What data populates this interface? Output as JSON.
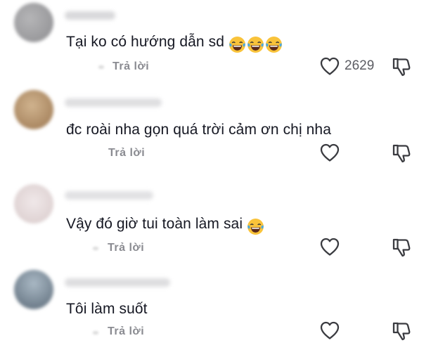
{
  "comments": [
    {
      "text": "Tại ko có hướng dẫn sd",
      "emoji_count": 3,
      "reply_label": "Trả lời",
      "like_count": "2629",
      "avatar_color": "#9a9a9c",
      "username_color": "#b9b9bd"
    },
    {
      "text": "đc roài nha gọn quá trời cảm ơn chị nha",
      "emoji_count": 0,
      "reply_label": "Trả lời",
      "like_count": "",
      "avatar_color": "#b08a62",
      "username_color": "#c4c4c8"
    },
    {
      "text": "Vậy đó giờ tui toàn làm sai",
      "emoji_count": 1,
      "reply_label": "Trả lời",
      "like_count": "",
      "avatar_color": "#e4dadb",
      "username_color": "#c9c9cd"
    },
    {
      "text": "Tôi làm suốt",
      "emoji_count": 0,
      "reply_label": "Trả lời",
      "like_count": "",
      "avatar_color": "#6c7a86",
      "username_color": "#c2c2c6"
    }
  ],
  "icons": {
    "like": "heart-outline-icon",
    "dislike": "thumbs-down-icon",
    "emoji": "face-with-tears-of-joy-icon"
  },
  "colors": {
    "text": "#161823",
    "secondary": "#8a8b91",
    "icon": "#3a3b40",
    "emoji_face": "#f9c33a"
  }
}
